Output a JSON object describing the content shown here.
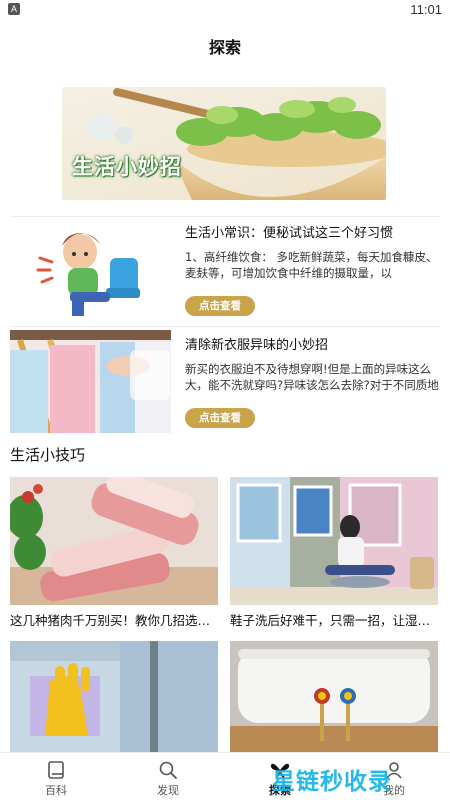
{
  "status": {
    "badge": "A",
    "time": "11:01"
  },
  "header": {
    "title": "探索"
  },
  "banner": {
    "text": "生活小妙招"
  },
  "articles": [
    {
      "title": "生活小常识：便秘试试这三个好习惯",
      "summary": "1、高纤维饮食：       多吃新鲜蔬菜，每天加食糠皮、麦麸等，可增加饮食中纤维的摄取量，以",
      "button": "点击查看",
      "image_icon": "constipation-illustration"
    },
    {
      "title": "清除新衣服异味的小妙招",
      "summary": "新买的衣服迫不及待想穿啊!但是上面的异味这么大，能不洗就穿吗?异味该怎么去除?对于不同质地",
      "button": "点击查看",
      "image_icon": "clothes-rack-photo"
    }
  ],
  "section": {
    "title": "生活小技巧"
  },
  "tips": [
    {
      "caption": "这几种猪肉千万别买！教你几招选…"
    },
    {
      "caption": "鞋子洗后好难干，只需一招，让湿…"
    },
    {
      "caption": ""
    },
    {
      "caption": ""
    }
  ],
  "tabs": [
    {
      "label": "百科",
      "icon": "book-icon",
      "active": false
    },
    {
      "label": "发现",
      "icon": "search-icon",
      "active": false
    },
    {
      "label": "探索",
      "icon": "butterfly-icon",
      "active": true
    },
    {
      "label": "我的",
      "icon": "profile-icon",
      "active": false
    }
  ],
  "watermark": {
    "text": "星链秒收录"
  },
  "colors": {
    "button": "#c9a44a",
    "watermark": "#19b6e8"
  }
}
